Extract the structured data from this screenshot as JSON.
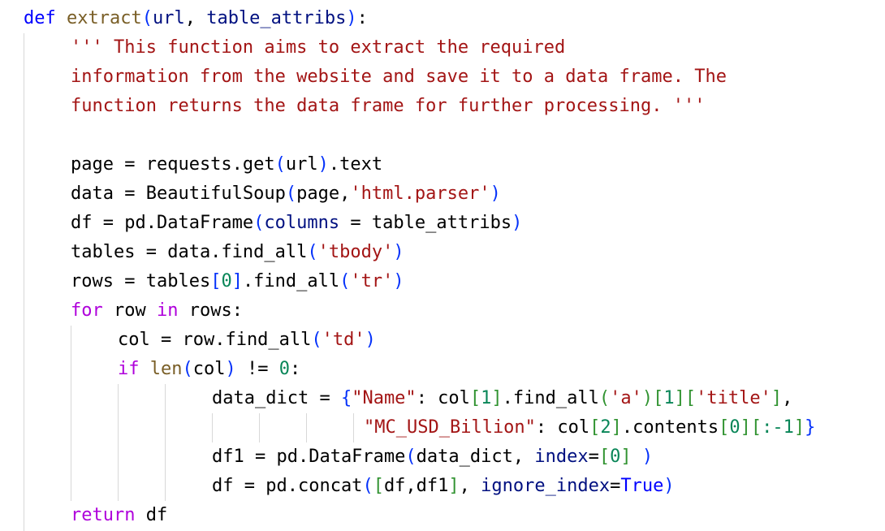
{
  "code": {
    "lines": [
      [
        {
          "t": "def ",
          "c": "kw"
        },
        {
          "t": "extract",
          "c": "fn"
        },
        {
          "t": "(",
          "c": "bracket-1"
        },
        {
          "t": "url",
          "c": "param"
        },
        {
          "t": ", ",
          "c": "plain"
        },
        {
          "t": "table_attribs",
          "c": "param"
        },
        {
          "t": ")",
          "c": "bracket-1"
        },
        {
          "t": ":",
          "c": "plain"
        }
      ],
      [
        {
          "t": "''' This function aims to extract the required",
          "c": "str"
        }
      ],
      [
        {
          "t": "information from the website and save it to a data frame. The",
          "c": "str"
        }
      ],
      [
        {
          "t": "function returns the data frame for further processing. '''",
          "c": "str"
        }
      ],
      [],
      [
        {
          "t": "page = requests.get",
          "c": "plain"
        },
        {
          "t": "(",
          "c": "bracket-1"
        },
        {
          "t": "url",
          "c": "plain"
        },
        {
          "t": ")",
          "c": "bracket-1"
        },
        {
          "t": ".text",
          "c": "plain"
        }
      ],
      [
        {
          "t": "data = BeautifulSoup",
          "c": "plain"
        },
        {
          "t": "(",
          "c": "bracket-1"
        },
        {
          "t": "page,",
          "c": "plain"
        },
        {
          "t": "'html.parser'",
          "c": "str"
        },
        {
          "t": ")",
          "c": "bracket-1"
        }
      ],
      [
        {
          "t": "df = pd.DataFrame",
          "c": "plain"
        },
        {
          "t": "(",
          "c": "bracket-1"
        },
        {
          "t": "columns",
          "c": "param"
        },
        {
          "t": " = table_attribs",
          "c": "plain"
        },
        {
          "t": ")",
          "c": "bracket-1"
        }
      ],
      [
        {
          "t": "tables = data.find_all",
          "c": "plain"
        },
        {
          "t": "(",
          "c": "bracket-1"
        },
        {
          "t": "'tbody'",
          "c": "str"
        },
        {
          "t": ")",
          "c": "bracket-1"
        }
      ],
      [
        {
          "t": "rows = tables",
          "c": "plain"
        },
        {
          "t": "[",
          "c": "bracket-1"
        },
        {
          "t": "0",
          "c": "num"
        },
        {
          "t": "]",
          "c": "bracket-1"
        },
        {
          "t": ".find_all",
          "c": "plain"
        },
        {
          "t": "(",
          "c": "bracket-1"
        },
        {
          "t": "'tr'",
          "c": "str"
        },
        {
          "t": ")",
          "c": "bracket-1"
        }
      ],
      [
        {
          "t": "for",
          "c": "ctrl"
        },
        {
          "t": " row ",
          "c": "plain"
        },
        {
          "t": "in",
          "c": "ctrl"
        },
        {
          "t": " rows:",
          "c": "plain"
        }
      ],
      [
        {
          "t": "col = row.find_all",
          "c": "plain"
        },
        {
          "t": "(",
          "c": "bracket-1"
        },
        {
          "t": "'td'",
          "c": "str"
        },
        {
          "t": ")",
          "c": "bracket-1"
        }
      ],
      [
        {
          "t": "if",
          "c": "ctrl"
        },
        {
          "t": " ",
          "c": "plain"
        },
        {
          "t": "len",
          "c": "fn"
        },
        {
          "t": "(",
          "c": "bracket-1"
        },
        {
          "t": "col",
          "c": "plain"
        },
        {
          "t": ")",
          "c": "bracket-1"
        },
        {
          "t": " != ",
          "c": "plain"
        },
        {
          "t": "0",
          "c": "num"
        },
        {
          "t": ":",
          "c": "plain"
        }
      ],
      [
        {
          "t": "data_dict = ",
          "c": "plain"
        },
        {
          "t": "{",
          "c": "bracket-1"
        },
        {
          "t": "\"Name\"",
          "c": "str"
        },
        {
          "t": ": col",
          "c": "plain"
        },
        {
          "t": "[",
          "c": "bracket-2"
        },
        {
          "t": "1",
          "c": "num"
        },
        {
          "t": "]",
          "c": "bracket-2"
        },
        {
          "t": ".find_all",
          "c": "plain"
        },
        {
          "t": "(",
          "c": "bracket-2"
        },
        {
          "t": "'a'",
          "c": "str"
        },
        {
          "t": ")",
          "c": "bracket-2"
        },
        {
          "t": "[",
          "c": "bracket-2"
        },
        {
          "t": "1",
          "c": "num"
        },
        {
          "t": "]",
          "c": "bracket-2"
        },
        {
          "t": "[",
          "c": "bracket-2"
        },
        {
          "t": "'title'",
          "c": "str"
        },
        {
          "t": "]",
          "c": "bracket-2"
        },
        {
          "t": ",",
          "c": "plain"
        }
      ],
      [
        {
          "t": "\"MC_USD_Billion\"",
          "c": "str"
        },
        {
          "t": ": col",
          "c": "plain"
        },
        {
          "t": "[",
          "c": "bracket-2"
        },
        {
          "t": "2",
          "c": "num"
        },
        {
          "t": "]",
          "c": "bracket-2"
        },
        {
          "t": ".contents",
          "c": "plain"
        },
        {
          "t": "[",
          "c": "bracket-2"
        },
        {
          "t": "0",
          "c": "num"
        },
        {
          "t": "]",
          "c": "bracket-2"
        },
        {
          "t": "[",
          "c": "bracket-2"
        },
        {
          "t": ":-1",
          "c": "num"
        },
        {
          "t": "]",
          "c": "bracket-2"
        },
        {
          "t": "}",
          "c": "bracket-1"
        }
      ],
      [
        {
          "t": "df1 = pd.DataFrame",
          "c": "plain"
        },
        {
          "t": "(",
          "c": "bracket-1"
        },
        {
          "t": "data_dict, ",
          "c": "plain"
        },
        {
          "t": "index",
          "c": "param"
        },
        {
          "t": "=",
          "c": "plain"
        },
        {
          "t": "[",
          "c": "bracket-2"
        },
        {
          "t": "0",
          "c": "num"
        },
        {
          "t": "]",
          "c": "bracket-2"
        },
        {
          "t": " ",
          "c": "plain"
        },
        {
          "t": ")",
          "c": "bracket-1"
        }
      ],
      [
        {
          "t": "df = pd.concat",
          "c": "plain"
        },
        {
          "t": "(",
          "c": "bracket-1"
        },
        {
          "t": "[",
          "c": "bracket-2"
        },
        {
          "t": "df,df1",
          "c": "plain"
        },
        {
          "t": "]",
          "c": "bracket-2"
        },
        {
          "t": ", ",
          "c": "plain"
        },
        {
          "t": "ignore_index",
          "c": "param"
        },
        {
          "t": "=",
          "c": "plain"
        },
        {
          "t": "True",
          "c": "kw"
        },
        {
          "t": ")",
          "c": "bracket-1"
        }
      ],
      [
        {
          "t": "return",
          "c": "ctrl"
        },
        {
          "t": " df",
          "c": "plain"
        }
      ]
    ]
  }
}
